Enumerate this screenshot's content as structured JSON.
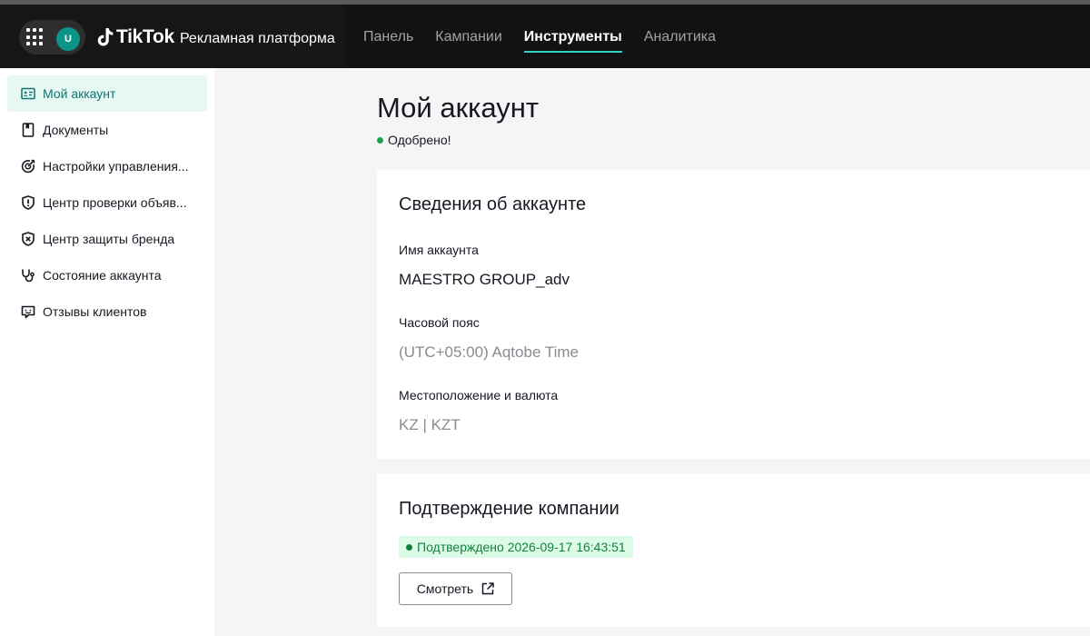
{
  "header": {
    "avatar_initial": "U",
    "logo_word": "TikTok",
    "logo_sub": "Рекламная платформа",
    "nav": [
      {
        "label": "Панель",
        "active": false
      },
      {
        "label": "Кампании",
        "active": false
      },
      {
        "label": "Инструменты",
        "active": true
      },
      {
        "label": "Аналитика",
        "active": false
      }
    ]
  },
  "sidebar": {
    "items": [
      {
        "label": "Мой аккаунт",
        "icon": "account-card-icon",
        "active": true
      },
      {
        "label": "Документы",
        "icon": "document-icon",
        "active": false
      },
      {
        "label": "Настройки управления...",
        "icon": "target-settings-icon",
        "active": false
      },
      {
        "label": "Центр проверки объяв...",
        "icon": "shield-check-icon",
        "active": false
      },
      {
        "label": "Центр защиты бренда",
        "icon": "shield-x-icon",
        "active": false
      },
      {
        "label": "Состояние аккаунта",
        "icon": "stethoscope-icon",
        "active": false
      },
      {
        "label": "Отзывы клиентов",
        "icon": "feedback-icon",
        "active": false
      }
    ]
  },
  "main": {
    "title": "Мой аккаунт",
    "status": "Одобрено!",
    "account_card": {
      "title": "Сведения об аккаунте",
      "fields": [
        {
          "label": "Имя аккаунта",
          "value": "MAESTRO GROUP_adv"
        },
        {
          "label": "Часовой пояс",
          "value": "(UTC+05:00) Aqtobe Time"
        },
        {
          "label": "Местоположение и валюта",
          "value": "KZ | KZT"
        }
      ]
    },
    "verification_card": {
      "title": "Подтверждение компании",
      "badge": "Подтверждено 2026-09-17 16:43:51",
      "button": "Смотреть"
    }
  },
  "colors": {
    "accent": "#2dd4bf",
    "active_bg": "#e6f7f4",
    "success": "#16a34a"
  }
}
